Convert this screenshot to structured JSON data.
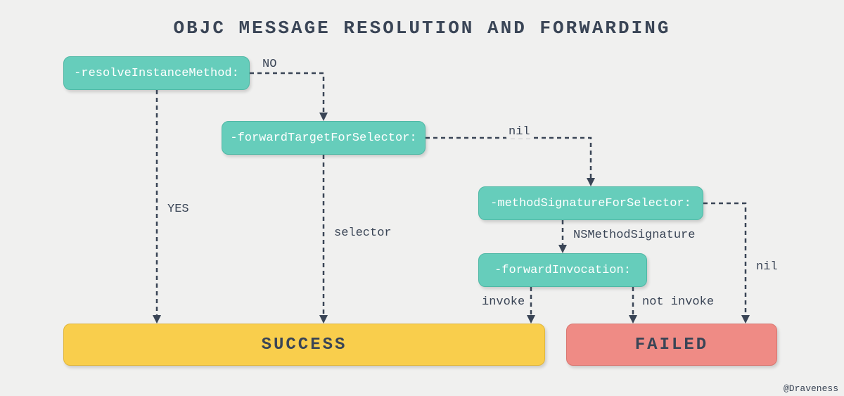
{
  "title": "OBJC MESSAGE RESOLUTION AND FORWARDING",
  "nodes": {
    "resolve": "-resolveInstanceMethod:",
    "forwardTarget": "-forwardTargetForSelector:",
    "methodSig": "-methodSignatureForSelector:",
    "forwardInv": "-forwardInvocation:"
  },
  "results": {
    "success": "SUCCESS",
    "failed": "FAILED"
  },
  "labels": {
    "no": "NO",
    "yes": "YES",
    "nil1": "nil",
    "selector": "selector",
    "nsmsig": "NSMethodSignature",
    "nil2": "nil",
    "invoke": "invoke",
    "notinvoke": "not invoke"
  },
  "credit": "@Draveness"
}
